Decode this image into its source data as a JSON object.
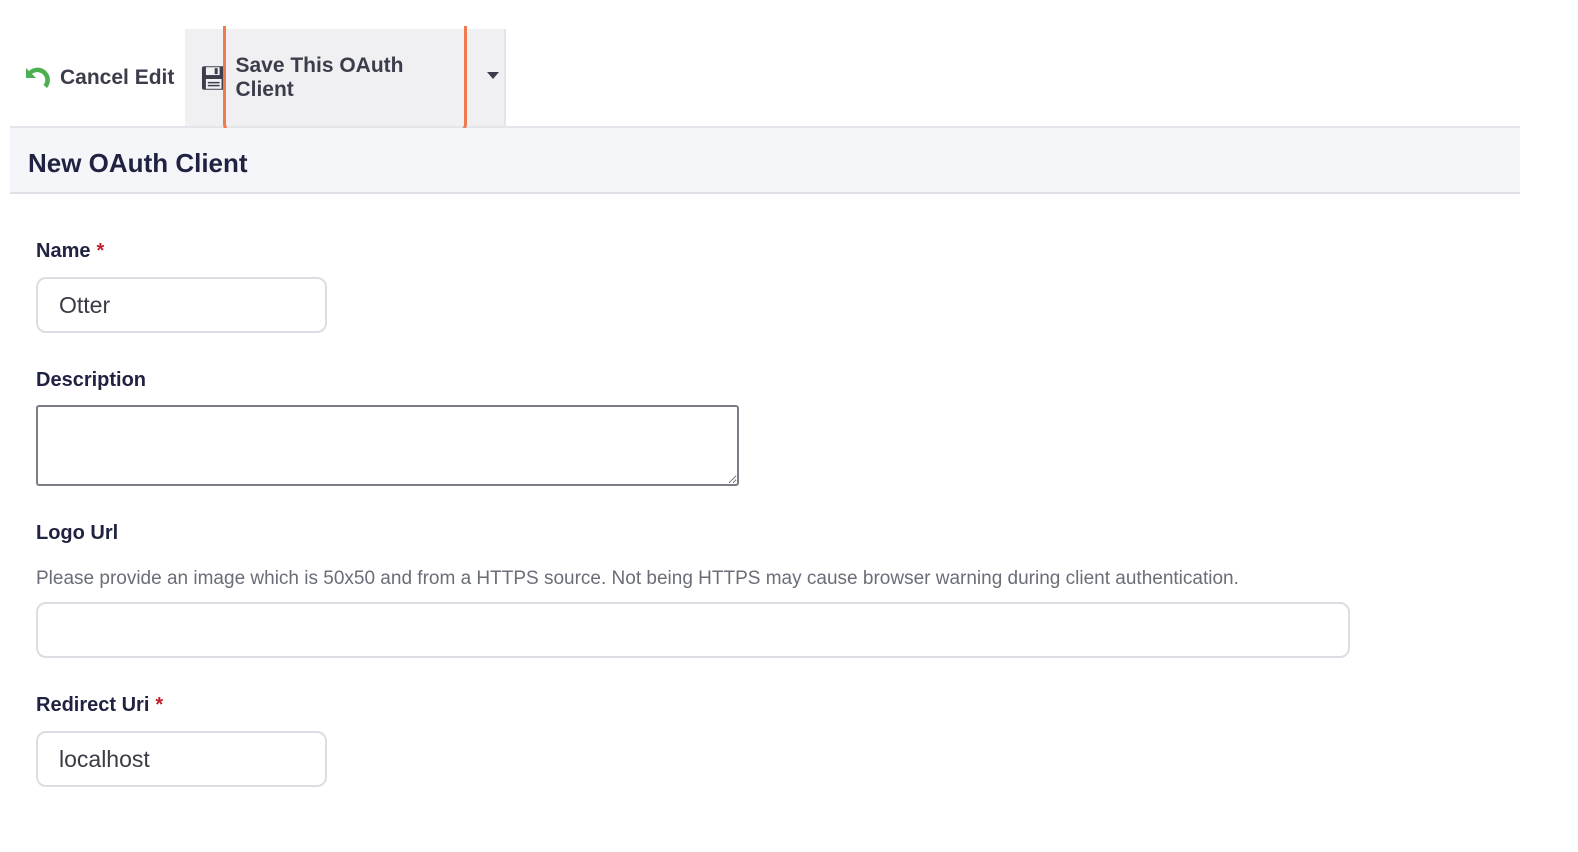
{
  "toolbar": {
    "cancel_label": "Cancel Edit",
    "save_label": "Save This OAuth Client",
    "cancel_icon_color": "#4caf50",
    "highlight_color": "#f07a4f"
  },
  "header": {
    "title": "New OAuth Client"
  },
  "form": {
    "name": {
      "label": "Name",
      "required_mark": "*",
      "value": "Otter"
    },
    "description": {
      "label": "Description",
      "value": ""
    },
    "logo_url": {
      "label": "Logo Url",
      "help": "Please provide an image which is 50x50 and from a HTTPS source. Not being HTTPS may cause browser warning during client authentication.",
      "value": ""
    },
    "redirect_uri": {
      "label": "Redirect Uri",
      "required_mark": "*",
      "value": "localhost"
    }
  }
}
